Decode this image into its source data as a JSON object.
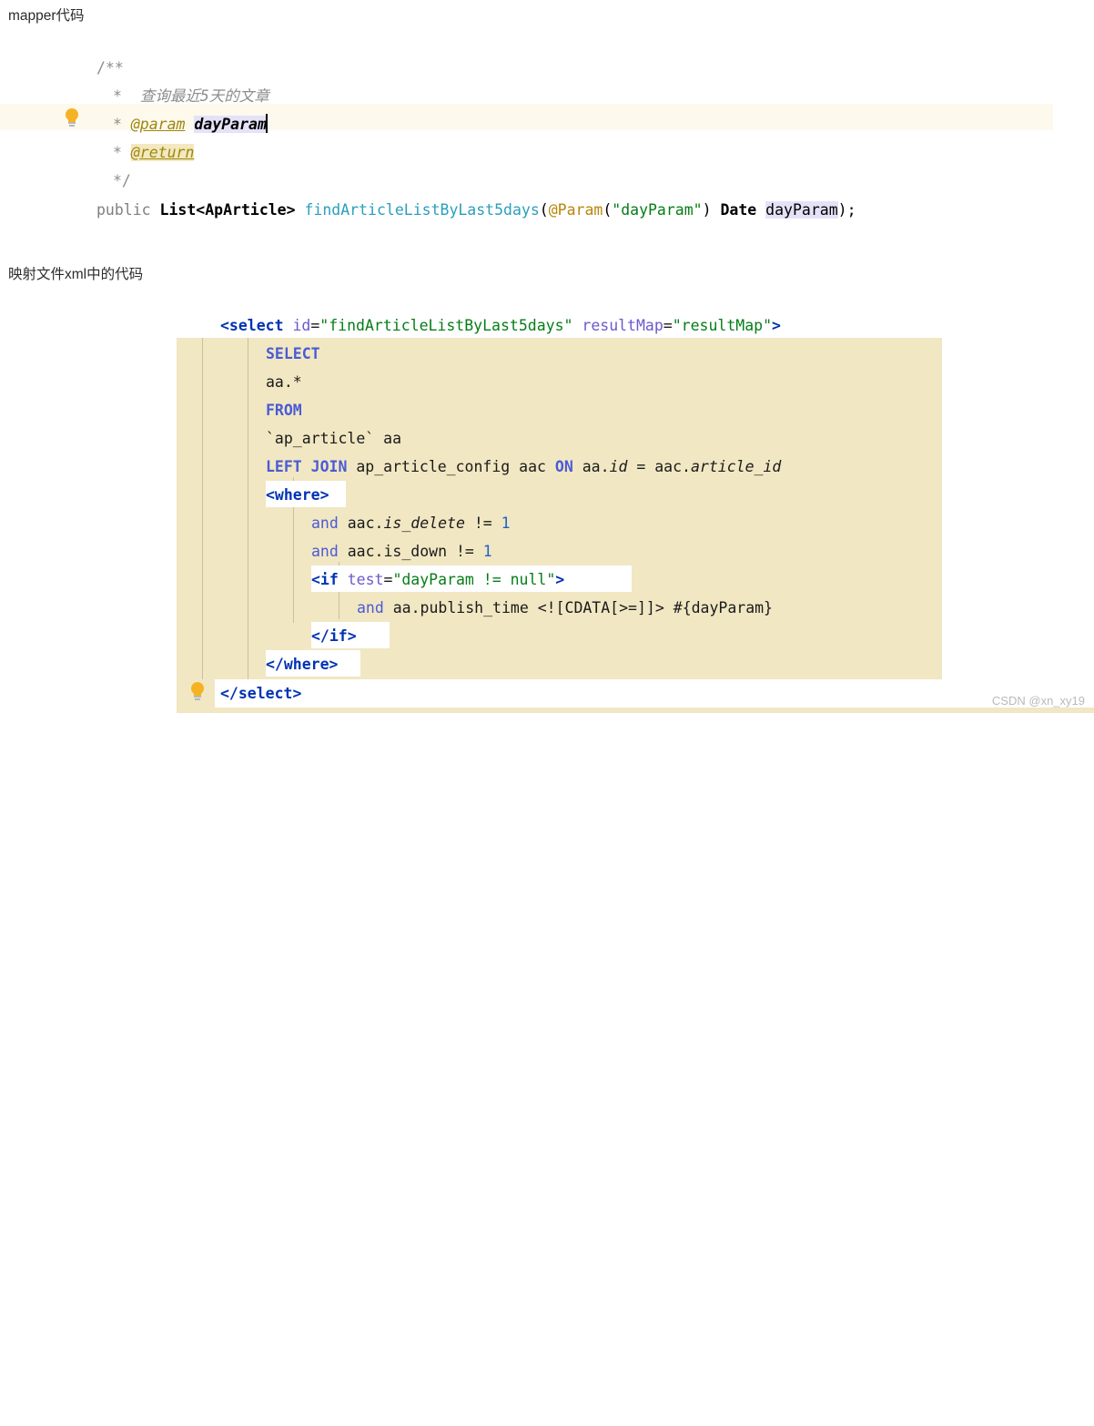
{
  "page": {
    "watermark": "CSDN @xn_xy19"
  },
  "sections": {
    "mapper": {
      "heading": "mapper代码"
    },
    "xml": {
      "heading": "映射文件xml中的代码"
    }
  },
  "java_code": {
    "lines": [
      {
        "indent": 0,
        "text": "/**"
      },
      {
        "indent": 1,
        "text": "* 查询最近5天的文章"
      },
      {
        "indent": 1,
        "text": "* @param dayParam"
      },
      {
        "indent": 1,
        "text": "* @return"
      },
      {
        "indent": 1,
        "text": "*/"
      },
      {
        "indent": 0,
        "text": "public List<ApArticle> findArticleListByLast5days(@Param(\"dayParam\") Date dayParam);"
      }
    ],
    "tokens": {
      "doc_open": "/**",
      "doc_star": "*",
      "doc_summary": "查询最近5天的文章",
      "tag_param": "@param",
      "param_name": "dayParam",
      "tag_return": "@return",
      "doc_close": "*/",
      "modifier": "public",
      "return_type": "List<ApArticle>",
      "method_name": "findArticleListByLast5days",
      "open_paren": "(",
      "annotation": "@Param",
      "anno_open": "(",
      "anno_string": "\"dayParam\"",
      "anno_close": ")",
      "param_type": "Date",
      "arg_name": "dayParam",
      "close_paren": ")",
      "semicolon": ";"
    },
    "gutter_icon": "lightbulb-icon"
  },
  "xml_code": {
    "lines": [
      {
        "indent": 0,
        "text": "<select id=\"findArticleListByLast5days\" resultMap=\"resultMap\">"
      },
      {
        "indent": 1,
        "text": "SELECT"
      },
      {
        "indent": 1,
        "text": "aa.*"
      },
      {
        "indent": 1,
        "text": "FROM"
      },
      {
        "indent": 1,
        "text": "`ap_article` aa"
      },
      {
        "indent": 1,
        "text": "LEFT JOIN ap_article_config aac ON aa.id = aac.article_id"
      },
      {
        "indent": 1,
        "text": "<where>"
      },
      {
        "indent": 2,
        "text": "and aac.is_delete != 1"
      },
      {
        "indent": 2,
        "text": "and aac.is_down != 1"
      },
      {
        "indent": 2,
        "text": "<if test=\"dayParam != null\">"
      },
      {
        "indent": 3,
        "text": "and aa.publish_time <![CDATA[>=]]> #{dayParam}"
      },
      {
        "indent": 2,
        "text": "</if>"
      },
      {
        "indent": 1,
        "text": "</where>"
      },
      {
        "indent": 0,
        "text": "</select>"
      }
    ],
    "tokens": {
      "select_open_tag": "<select",
      "attr_id": "id",
      "eq": "=",
      "val_id": "\"findArticleListByLast5days\"",
      "attr_resultmap": "resultMap",
      "val_resultmap": "\"resultMap\"",
      "gt": ">",
      "kw_select": "SELECT",
      "star_cols": "aa.*",
      "kw_from": "FROM",
      "table_ref": "`ap_article` aa",
      "kw_left_join": "LEFT JOIN",
      "join_table": "ap_article_config aac",
      "kw_on": "ON",
      "on_left": "aa.",
      "on_left_col": "id",
      "on_eq": "=",
      "on_right": "aac.",
      "on_right_col": "article_id",
      "where_open": "<where>",
      "and": "and",
      "cond1_col": "aac.",
      "cond1_field": "is_delete",
      "neq": "!=",
      "one": "1",
      "cond2_col": "aac.is_down",
      "if_open_tag": "<if",
      "attr_test": "test",
      "val_test": "\"dayParam != null\"",
      "cond3_col": "aa.publish_time",
      "cdata": "<![CDATA[>=]]>",
      "bind_param": "#{dayParam}",
      "if_close": "</if>",
      "where_close": "</where>",
      "select_close": "</select>"
    },
    "gutter_icon": "lightbulb-icon"
  },
  "colors": {
    "page_background": "#ffffff",
    "selection_tan": "#f1e7c3",
    "selection_lavender": "#e5e2f7",
    "caret_line": "#fdf9ed",
    "keyword_blue": "#0033b3",
    "string_green": "#067d17",
    "method_cyan": "#2a9fbc",
    "annotation_gold": "#b8860b",
    "comment_gray": "#8c8c8c",
    "lightbulb_amber": "#f5b324",
    "watermark_gray": "#b9b9b9"
  }
}
